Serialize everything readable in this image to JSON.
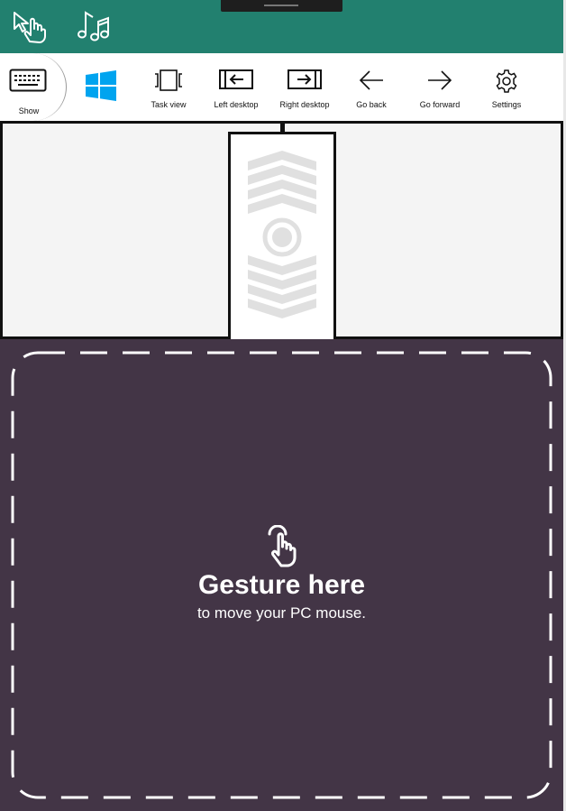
{
  "header": {
    "touch_icon": "touch-mouse-icon",
    "music_icon": "music-notes-icon"
  },
  "toolbar": {
    "show_label": "Show",
    "windows_icon": "windows-logo-icon",
    "items": [
      {
        "label": "Task view",
        "icon": "task-view-icon"
      },
      {
        "label": "Left desktop",
        "icon": "left-desktop-icon"
      },
      {
        "label": "Right desktop",
        "icon": "right-desktop-icon"
      },
      {
        "label": "Go back",
        "icon": "arrow-left-icon"
      },
      {
        "label": "Go forward",
        "icon": "arrow-right-icon"
      },
      {
        "label": "Settings",
        "icon": "gear-icon"
      }
    ]
  },
  "gesture": {
    "title": "Gesture here",
    "subtitle": "to move your PC mouse."
  },
  "colors": {
    "header": "#22806f",
    "gesture_bg": "#433546",
    "windows_blue": "#00a4ef"
  }
}
